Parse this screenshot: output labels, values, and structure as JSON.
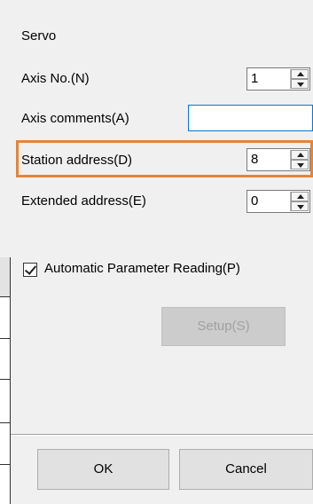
{
  "section_title": "Servo",
  "fields": {
    "axis_no": {
      "label": "Axis No.(N)",
      "value": "1"
    },
    "axis_comments": {
      "label": "Axis comments(A)",
      "value": ""
    },
    "station_address": {
      "label": "Station address(D)",
      "value": "8"
    },
    "extended_address": {
      "label": "Extended address(E)",
      "value": "0"
    }
  },
  "auto_param": {
    "label": "Automatic Parameter Reading(P)",
    "checked": true
  },
  "buttons": {
    "setup": "Setup(S)",
    "ok": "OK",
    "cancel": "Cancel"
  },
  "colors": {
    "highlight": "#e2853a",
    "focus_border": "#0078d7"
  }
}
